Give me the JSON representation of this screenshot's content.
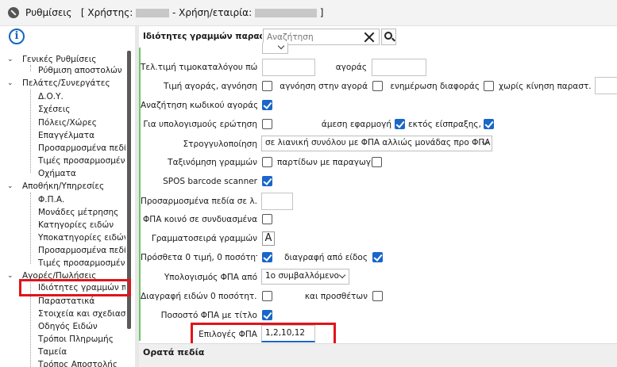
{
  "window": {
    "title_prefix": "Ρυθμίσεις   [ Χρήστης: ",
    "title_middle": " - Χρήση/εταιρία: ",
    "title_suffix": " ]"
  },
  "sidebar": {
    "groups": [
      {
        "label": "Γενικές Ρυθμίσεις",
        "items": [
          "Ρύθμιση αποστολών"
        ]
      },
      {
        "label": "Πελάτες/Συνεργάτες",
        "items": [
          "Δ.Ο.Υ.",
          "Σχέσεις",
          "Πόλεις/Χώρες",
          "Επαγγέλματα",
          "Προσαρμοσμένα πεδί",
          "Τιμές προσαρμοσμένο",
          "Οχήματα"
        ]
      },
      {
        "label": "Αποθήκη/Υπηρεσίες",
        "items": [
          "Φ.Π.Α.",
          "Μονάδες μέτρησης",
          "Κατηγορίες ειδών",
          "Υποκατηγορίες ειδών",
          "Προσαρμοσμένα πεδί",
          "Τιμές προσαρμοσμένο"
        ]
      },
      {
        "label": "Αγορές/Πωλήσεις",
        "items": [
          "Ιδιότητες γραμμών πα",
          "Παραστατικά",
          "Στοιχεία και σχεδιασμό",
          "Οδηγός Ειδών",
          "Τρόποι Πληρωμής",
          "Ταμεία",
          "Τρόπος Αποστολής"
        ]
      }
    ]
  },
  "panel": {
    "title": "Ιδιότητες γραμμών παρασ...",
    "search_placeholder": "Αναζήτηση"
  },
  "form": {
    "price_list_label": "Τελ.τιμή τιμοκαταλόγου πώ...",
    "purchase_label": "αγοράς",
    "purchase_price_label": "Τιμή αγοράς, αγνόηση",
    "ignore_in_purchase_label": "αγνόηση στην αγορά",
    "update_diff_label": "ενημέρωση διαφοράς",
    "no_move_label": "χωρίς κίνηση παραστ...",
    "search_code_label": "Αναζήτηση κωδικού αγοράς",
    "calc_question_label": "Για υπολογισμούς ερώτηση",
    "immediate_apply_label": "άμεση εφαρμογή",
    "except_collection_label": "εκτός είσπραξης, πλη...",
    "rounding_label": "Στρογγυλοποίηση",
    "rounding_value": "σε λιανική συνόλου με ΦΠΑ αλλιώς μονάδας προ ΦΠΑ",
    "sort_lines_label": "Ταξινόμηση γραμμών",
    "batches_label": "παρτίδων με παραγωγή",
    "spos_label": "SPOS barcode scanner",
    "custom_fields_label": "Προσαρμοσμένα πεδία σε λ...",
    "common_vat_label": "ΦΠΑ κοινό σε συνδυασμένα",
    "font_label": "Γραμματοσειρά γραμμών",
    "font_button": "A",
    "extra_zero_label": "Πρόσθετα 0 τιμή,  0 ποσότητα",
    "delete_from_item_label": "διαγραφή από είδος",
    "vat_calc_label": "Υπολογισμός ΦΠΑ από",
    "vat_calc_value": "1ο συμβαλλόμενο",
    "delete_zero_label": "Διαγραφή ειδών 0 ποσότητ...",
    "and_extras_label": "και προσθέτων",
    "vat_pct_title_label": "Ποσοστό ΦΠΑ με τίτλο",
    "vat_options_label": "Επιλογές ΦΠΑ",
    "vat_options_value": "1,2,10,12"
  },
  "section": {
    "visible_fields": "Ορατά πεδία"
  },
  "colors": {
    "highlight_border": "#e0141a",
    "checkbox_on": "#1a66c9",
    "accent_line": "#6cc66c",
    "info_blue": "#1565c0"
  }
}
